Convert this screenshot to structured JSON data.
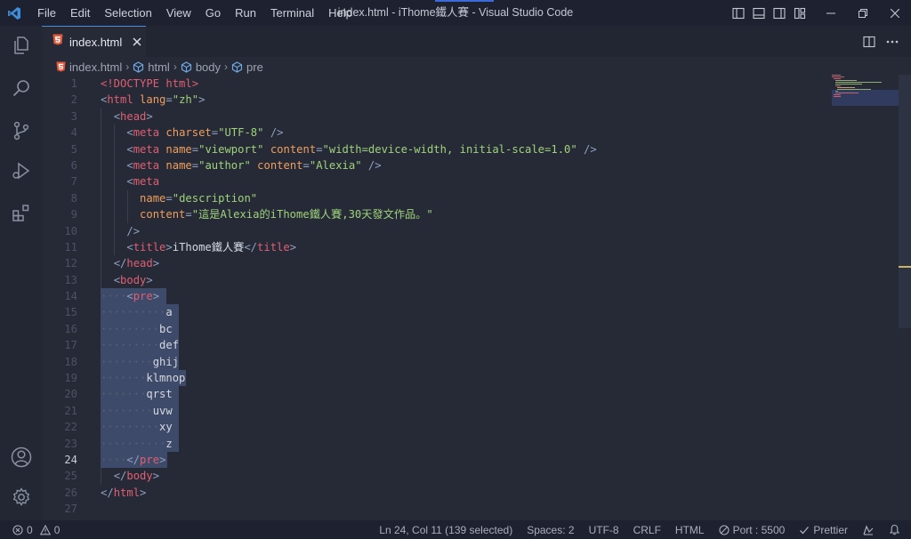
{
  "titlebar": {
    "menu": [
      "File",
      "Edit",
      "Selection",
      "View",
      "Go",
      "Run",
      "Terminal",
      "Help"
    ],
    "window_title": "index.html - iThome鐵人賽 - Visual Studio Code"
  },
  "tab": {
    "label": "index.html"
  },
  "breadcrumb": {
    "file": "index.html",
    "seg1": "html",
    "seg2": "body",
    "seg3": "pre"
  },
  "editor": {
    "active_line": 24,
    "line_numbers": [
      "1",
      "2",
      "3",
      "4",
      "5",
      "6",
      "7",
      "8",
      "9",
      "10",
      "11",
      "12",
      "13",
      "14",
      "15",
      "16",
      "17",
      "18",
      "19",
      "20",
      "21",
      "22",
      "23",
      "24",
      "25",
      "26",
      "27"
    ]
  },
  "code": {
    "l1": {
      "doctype": "<!DOCTYPE html>"
    },
    "l2": {
      "open": "<",
      "tag": "html",
      "attr": "lang",
      "eq": "=",
      "val": "\"zh\"",
      "close": ">"
    },
    "l3": {
      "open": "<",
      "tag": "head",
      "close": ">"
    },
    "l4": {
      "open": "<",
      "tag": "meta",
      "attr": "charset",
      "eq": "=",
      "val": "\"UTF-8\"",
      "close": " />"
    },
    "l5": {
      "open": "<",
      "tag": "meta",
      "attr1": "name",
      "eq1": "=",
      "val1": "\"viewport\"",
      "attr2": "content",
      "eq2": "=",
      "val2": "\"width=device-width, initial-scale=1.0\"",
      "close": " />"
    },
    "l6": {
      "open": "<",
      "tag": "meta",
      "attr1": "name",
      "eq1": "=",
      "val1": "\"author\"",
      "attr2": "content",
      "eq2": "=",
      "val2": "\"Alexia\"",
      "close": " />"
    },
    "l7": {
      "open": "<",
      "tag": "meta"
    },
    "l8": {
      "attr": "name",
      "eq": "=",
      "val": "\"description\""
    },
    "l9": {
      "attr": "content",
      "eq": "=",
      "val": "\"這是Alexia的iThome鐵人賽,30天發文作品。\""
    },
    "l10": {
      "close": "/>"
    },
    "l11": {
      "open": "<",
      "tag": "title",
      "gt": ">",
      "text": "iThome鐵人賽",
      "open2": "</",
      "tag2": "title",
      "close": ">"
    },
    "l12": {
      "open": "</",
      "tag": "head",
      "close": ">"
    },
    "l13": {
      "open": "<",
      "tag": "body",
      "close": ">"
    },
    "l14": {
      "open": "<",
      "tag": "pre",
      "close": ">"
    },
    "l15": {
      "dots": "··········",
      "text": "a"
    },
    "l16": {
      "dots": "·········",
      "text": "bc"
    },
    "l17": {
      "dots": "·········",
      "text": "def"
    },
    "l18": {
      "dots": "········",
      "text": "ghij"
    },
    "l19": {
      "dots": "·······",
      "text": "klmnop"
    },
    "l20": {
      "dots": "·······",
      "text": "qrst"
    },
    "l21": {
      "dots": "········",
      "text": "uvw"
    },
    "l22": {
      "dots": "·········",
      "text": "xy"
    },
    "l23": {
      "dots": "··········",
      "text": "z"
    },
    "l24": {
      "dots": "····",
      "open": "</",
      "tag": "pre",
      "close": ">"
    },
    "l25": {
      "open": "</",
      "tag": "body",
      "close": ">"
    },
    "l26": {
      "open": "</",
      "tag": "html",
      "close": ">"
    }
  },
  "statusbar": {
    "errors": "0",
    "warnings": "0",
    "position": "Ln 24, Col 11 (139 selected)",
    "spaces": "Spaces: 2",
    "encoding": "UTF-8",
    "eol": "CRLF",
    "language": "HTML",
    "port": "Port : 5500",
    "prettier": "Prettier"
  },
  "colors": {
    "tag": "#e05f72",
    "attribute": "#ee9e5d",
    "string": "#9fd27a",
    "selection": "#3e4a69",
    "background": "#262a37"
  }
}
